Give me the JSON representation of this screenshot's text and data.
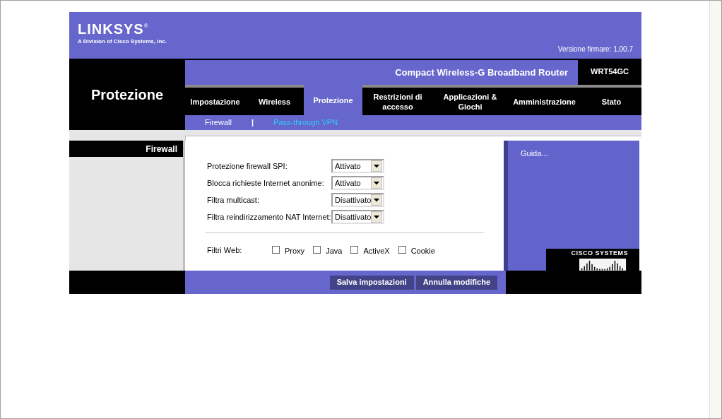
{
  "header": {
    "logo": "LINKSYS",
    "logo_mark": "®",
    "tagline": "A Division of Cisco Systems, Inc.",
    "firmware": "Versione firmare: 1.00.7"
  },
  "product": {
    "name": "Compact Wireless-G Broadband Router",
    "model": "WRT54GC"
  },
  "section_title": "Protezione",
  "tabs": [
    {
      "label": "Impostazione",
      "selected": false
    },
    {
      "label": "Wireless",
      "selected": false
    },
    {
      "label": "Protezione",
      "selected": true
    },
    {
      "label": "Restrizioni di accesso",
      "selected": false
    },
    {
      "label": "Applicazioni & Giochi",
      "selected": false
    },
    {
      "label": "Amministrazione",
      "selected": false
    },
    {
      "label": "Stato",
      "selected": false
    }
  ],
  "subtabs": [
    {
      "label": "Firewall",
      "selected": true
    },
    {
      "label": "Pass-through VPN",
      "selected": false
    }
  ],
  "subtab_separator": "|",
  "side_heading": "Firewall",
  "settings": [
    {
      "label": "Protezione firewall SPI:",
      "value": "Attivato"
    },
    {
      "label": "Blocca richieste Internet anonime:",
      "value": "Attivato"
    },
    {
      "label": "Filtra multicast:",
      "value": "Disattivato"
    },
    {
      "label": "Filtra reindirizzamento NAT Internet:",
      "value": "Disattivato"
    }
  ],
  "web_filters": {
    "label": "Filtri Web:",
    "options": [
      {
        "label": "Proxy",
        "checked": false
      },
      {
        "label": "Java",
        "checked": false
      },
      {
        "label": "ActiveX",
        "checked": false
      },
      {
        "label": "Cookie",
        "checked": false
      }
    ]
  },
  "help_link": "Guida...",
  "cisco_logo": "CISCO SYSTEMS",
  "buttons": [
    "Salva impostazioni",
    "Annulla modifiche"
  ]
}
